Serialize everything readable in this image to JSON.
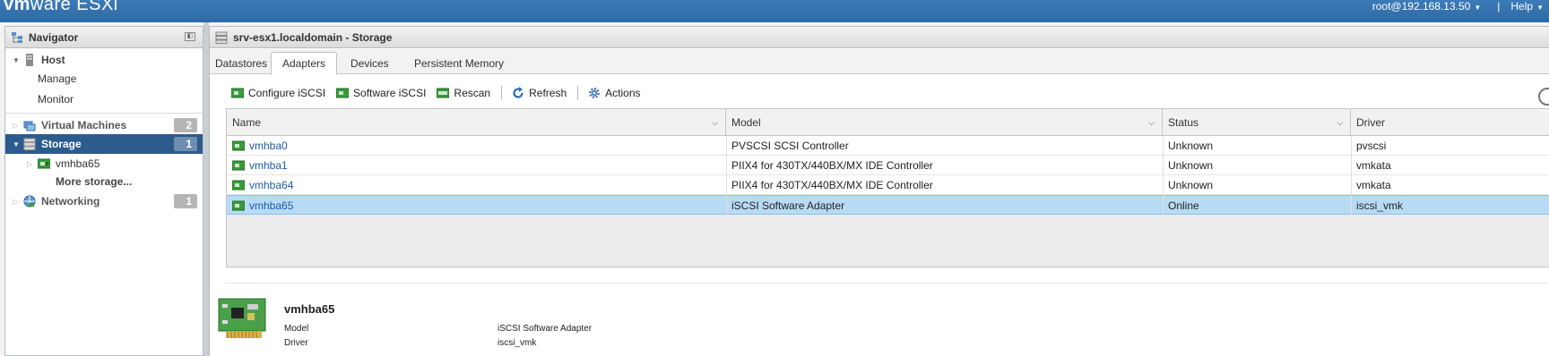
{
  "topbar": {
    "logo_vm": "vm",
    "logo_ware": "ware",
    "logo_product": "ESXi",
    "user": "root@192.168.13.50",
    "separator": "|",
    "help": "Help"
  },
  "navigator": {
    "title": "Navigator",
    "host": {
      "label": "Host",
      "children": [
        {
          "label": "Manage"
        },
        {
          "label": "Monitor"
        }
      ]
    },
    "virtual_machines": {
      "label": "Virtual Machines",
      "count": "2"
    },
    "storage": {
      "label": "Storage",
      "count": "1",
      "children": [
        {
          "label": "vmhba65"
        },
        {
          "label": "More storage..."
        }
      ]
    },
    "networking": {
      "label": "Networking",
      "count": "1"
    }
  },
  "main": {
    "title": "srv-esx1.localdomain - Storage",
    "tabs": [
      {
        "label": "Datastores",
        "active": false
      },
      {
        "label": "Adapters",
        "active": true
      },
      {
        "label": "Devices",
        "active": false
      },
      {
        "label": "Persistent Memory",
        "active": false
      }
    ],
    "toolbar": {
      "configure_iscsi": "Configure iSCSI",
      "software_iscsi": "Software iSCSI",
      "rescan": "Rescan",
      "refresh": "Refresh",
      "actions": "Actions"
    }
  },
  "grid": {
    "columns": [
      "Name",
      "Model",
      "Status",
      "Driver"
    ],
    "rows": [
      {
        "name": "vmhba0",
        "model": "PVSCSI SCSI Controller",
        "status": "Unknown",
        "driver": "pvscsi",
        "selected": false
      },
      {
        "name": "vmhba1",
        "model": "PIIX4 for 430TX/440BX/MX IDE Controller",
        "status": "Unknown",
        "driver": "vmkata",
        "selected": false
      },
      {
        "name": "vmhba64",
        "model": "PIIX4 for 430TX/440BX/MX IDE Controller",
        "status": "Unknown",
        "driver": "vmkata",
        "selected": false
      },
      {
        "name": "vmhba65",
        "model": "iSCSI Software Adapter",
        "status": "Online",
        "driver": "iscsi_vmk",
        "selected": true
      }
    ]
  },
  "details": {
    "title": "vmhba65",
    "fields": [
      {
        "label": "Model",
        "value": "iSCSI Software Adapter"
      },
      {
        "label": "Driver",
        "value": "iscsi_vmk"
      }
    ]
  },
  "colors": {
    "banner": "#2f6aa5",
    "selection_nav": "#2d5b8d",
    "selection_row": "#b8dbf5",
    "link": "#1e5aa0"
  }
}
